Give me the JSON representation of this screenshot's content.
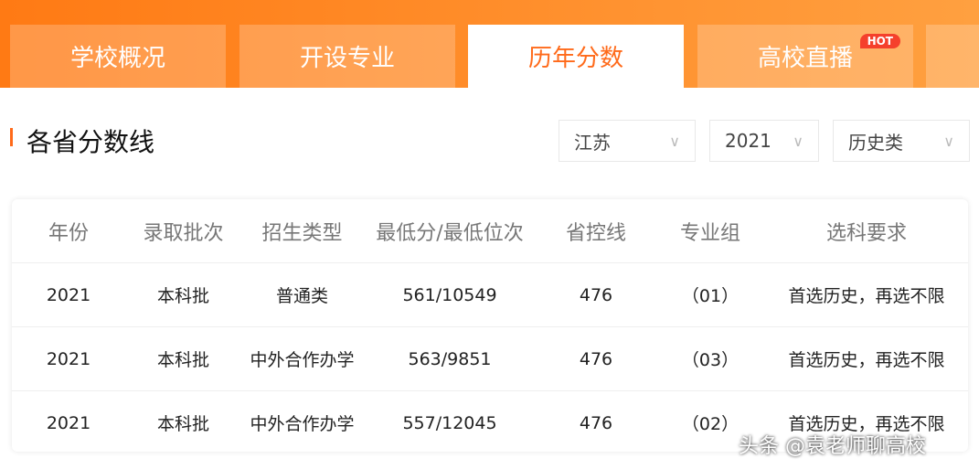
{
  "tabs": [
    {
      "label": "学校概况"
    },
    {
      "label": "开设专业"
    },
    {
      "label": "历年分数"
    },
    {
      "label": "高校直播",
      "badge": "HOT"
    }
  ],
  "section_title": "各省分数线",
  "filters": {
    "province": "江苏",
    "year": "2021",
    "category": "历史类"
  },
  "table": {
    "headers": [
      "年份",
      "录取批次",
      "招生类型",
      "最低分/最低位次",
      "省控线",
      "专业组",
      "选科要求"
    ],
    "rows": [
      [
        "2021",
        "本科批",
        "普通类",
        "561/10549",
        "476",
        "（01）",
        "首选历史，再选不限"
      ],
      [
        "2021",
        "本科批",
        "中外合作办学",
        "563/9851",
        "476",
        "（03）",
        "首选历史，再选不限"
      ],
      [
        "2021",
        "本科批",
        "中外合作办学",
        "557/12045",
        "476",
        "（02）",
        "首选历史，再选不限"
      ]
    ]
  },
  "watermark": "头条 @袁老师聊高校"
}
